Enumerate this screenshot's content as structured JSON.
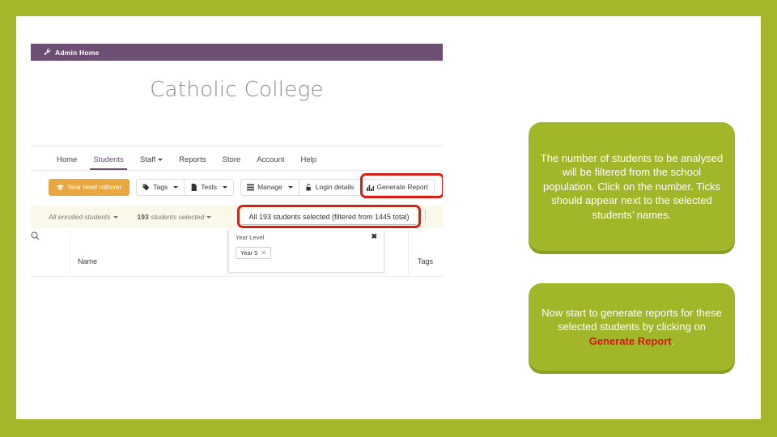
{
  "slide": {
    "frame_color": "#A5B62B",
    "canvas_color": "#FFFFFF"
  },
  "app": {
    "admin_bar": {
      "label": "Admin Home",
      "icon": "wrench-icon",
      "color": "#6D4F74"
    },
    "school_title": "Catholic College",
    "nav": {
      "items": [
        {
          "label": "Home",
          "active": false,
          "has_caret": false
        },
        {
          "label": "Students",
          "active": true,
          "has_caret": false
        },
        {
          "label": "Staff",
          "active": false,
          "has_caret": true
        },
        {
          "label": "Reports",
          "active": false,
          "has_caret": false
        },
        {
          "label": "Store",
          "active": false,
          "has_caret": false
        },
        {
          "label": "Account",
          "active": false,
          "has_caret": false
        },
        {
          "label": "Help",
          "active": false,
          "has_caret": false
        }
      ]
    },
    "toolbar": {
      "rollover_label": "Year level rollover",
      "rollover_icon": "graduation-cap-icon",
      "rollover_color": "#E9A83F",
      "tags_label": "Tags",
      "tags_icon": "tag-icon",
      "tests_label": "Tests",
      "tests_icon": "file-icon",
      "manage_label": "Manage",
      "manage_icon": "list-icon",
      "login_details_label": "Login details",
      "login_details_icon": "lock-icon",
      "generate_report_label": "Generate Report",
      "generate_report_icon": "bar-chart-icon"
    },
    "filter_row": {
      "enrolled_filter_label": "All enrolled students",
      "selected_count": "193",
      "selected_suffix": "students selected",
      "selection_summary": "All 193 students selected (filtered from 1445 total)",
      "background": "#FAF9E9"
    },
    "year_level_panel": {
      "title": "Year Level",
      "close_glyph": "✖",
      "chip_label": "Year 5",
      "chip_close_glyph": "✕"
    },
    "table": {
      "col_name": "Name",
      "col_tags": "Tags",
      "search_icon": "search-icon"
    },
    "highlights": {
      "color": "#D81F16",
      "generate_report_target": "Generate Report",
      "selection_summary_target": "All 193 students selected (filtered from 1445 total)"
    }
  },
  "callouts": [
    {
      "id": "filter-students",
      "text": "The number of students to be analysed will be filtered from the school population.  Click on the number. Ticks should appear next to the selected students’ names.",
      "color": "#A2B62A"
    },
    {
      "id": "generate-reports",
      "text_before": "Now start to generate reports for these selected students by clicking on ",
      "accent_text": "Generate Report",
      "text_after": ".",
      "color": "#A2B62A",
      "accent_color": "#D61A14"
    }
  ]
}
